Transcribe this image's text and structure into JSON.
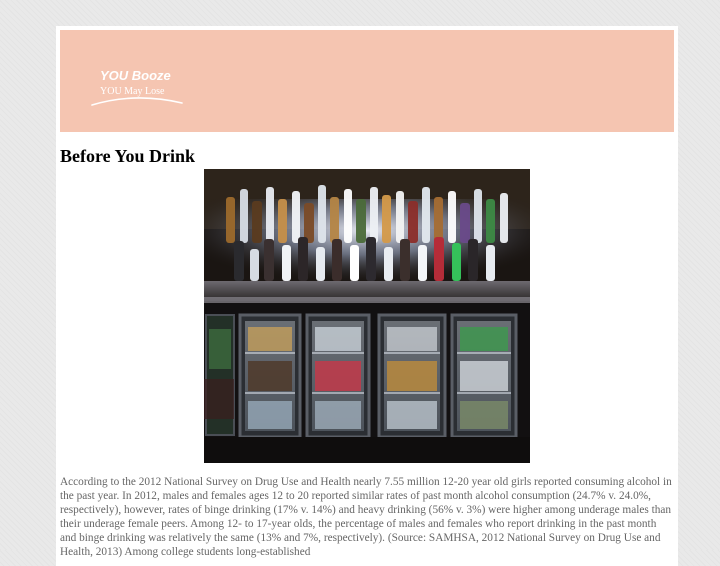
{
  "header": {
    "logo_title": "YOU Booze",
    "logo_tagline": "YOU May Lose",
    "background_color": "#f5c5b1"
  },
  "article": {
    "title": "Before You Drink",
    "image_description_icon": "bar-shelf-photo",
    "body": "According to the 2012 National Survey on Drug Use and Health nearly 7.55 million 12-20 year old girls reported consuming alcohol in the past year. In 2012, males and females ages 12 to 20 reported similar rates of past month alcohol consumption (24.7% v. 24.0%, respectively), however, rates of binge drinking (17% v. 14%) and heavy drinking (56% v. 3%) were higher among underage males than their underage female peers. Among 12- to 17-year olds, the percentage of males and females who report drinking in the past month and binge drinking was relatively the same (13% and 7%, respectively). (Source: SAMHSA, 2012 National Survey on Drug Use and Health, 2013) Among college students long-established"
  }
}
